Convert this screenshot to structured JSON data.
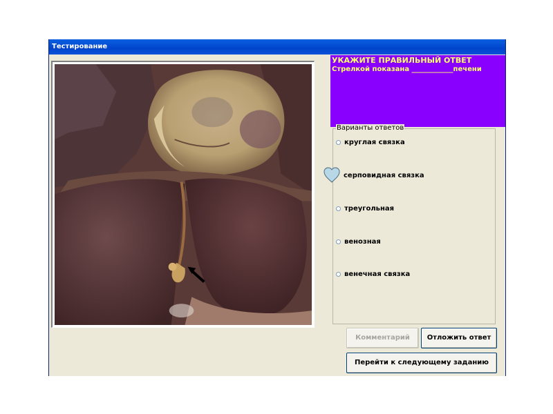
{
  "window": {
    "title": "Тестирование"
  },
  "question": {
    "header": "УКАЖИТЕ ПРАВИЛЬНЫЙ ОТВЕТ",
    "text": "Стрелкой показана ____________печени",
    "bg_color": "#8a00ff",
    "text_color": "#ffff66"
  },
  "answers": {
    "legend": "Варианты ответов",
    "options": [
      {
        "label": "круглая связка",
        "selected": false
      },
      {
        "label": "серповидная связка",
        "selected": true,
        "marker": "heart-icon"
      },
      {
        "label": "треугольная",
        "selected": false
      },
      {
        "label": "венозная",
        "selected": false
      },
      {
        "label": "венечная связка",
        "selected": false
      }
    ]
  },
  "buttons": {
    "comment": "Комментарий",
    "postpone": "Отложить ответ",
    "next": "Перейти к следующему заданию"
  }
}
